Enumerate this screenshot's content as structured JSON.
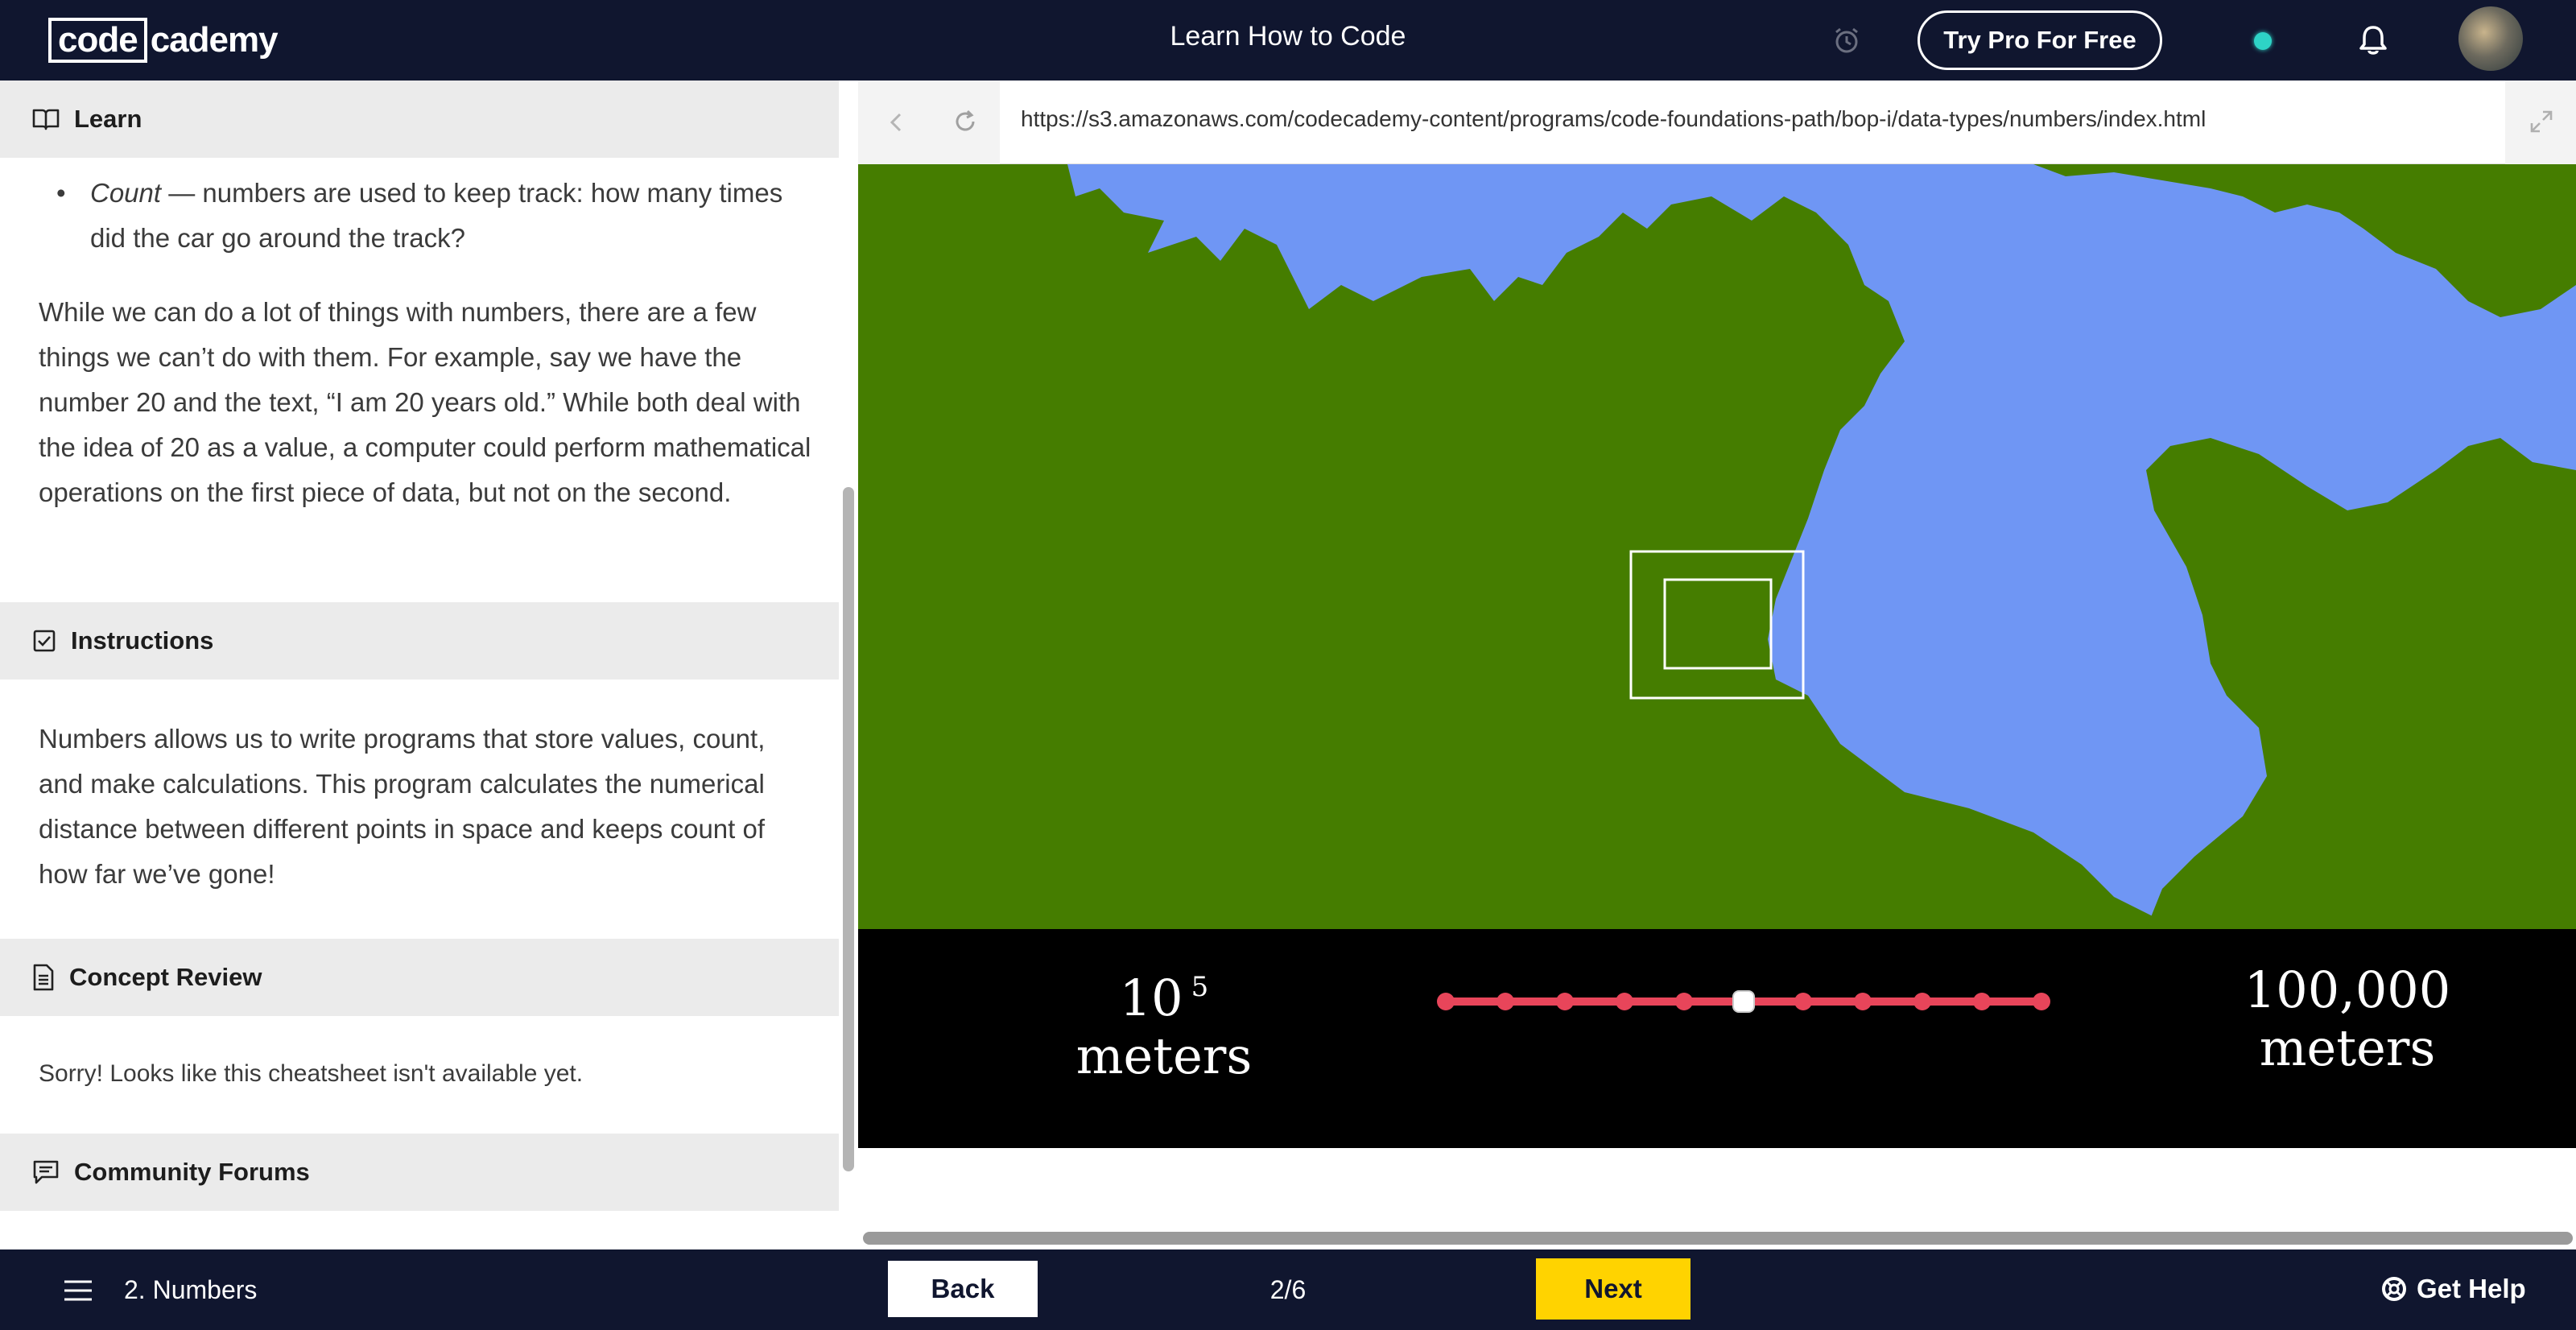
{
  "header": {
    "logo_code": "code",
    "logo_rest": "cademy",
    "title": "Learn How to Code",
    "try_pro_label": "Try Pro For Free"
  },
  "left_panel": {
    "learn_label": "Learn",
    "bullet_term": "Count",
    "bullet_text": " — numbers are used to keep track: how many times did the car go around the track?",
    "paragraph": "While we can do a lot of things with numbers, there are a few things we can’t do with them. For example, say we have the number 20 and the text, “I am 20 years old.” While both deal with the idea of 20 as a value, a computer could perform mathematical operations on the first piece of data, but not on the second.",
    "instructions_label": "Instructions",
    "instructions_text": "Numbers allows us to write programs that store values, count, and make calculations. This program calculates the numerical distance between different points in space and keeps count of how far we’ve gone!",
    "concept_review_label": "Concept Review",
    "concept_review_text": "Sorry! Looks like this cheatsheet isn't available yet.",
    "community_label": "Community Forums"
  },
  "browser": {
    "url": "https://s3.amazonaws.com/codecademy-content/programs/code-foundations-path/bop-i/data-types/numbers/index.html"
  },
  "scale_widget": {
    "exponent_base": "10",
    "exponent": "5",
    "unit": "meters",
    "value_display": "100,000",
    "slider_stops": 11,
    "slider_selected_index": 5,
    "track_color": "#e8455a"
  },
  "footer": {
    "lesson_name": "2. Numbers",
    "back_label": "Back",
    "progress": "2/6",
    "next_label": "Next",
    "help_label": "Get Help"
  },
  "colors": {
    "nav_bg": "#10162f",
    "land": "#457d00",
    "water": "#6f96f4",
    "next_button": "#ffd300",
    "status_dot": "#2ed3c6"
  }
}
